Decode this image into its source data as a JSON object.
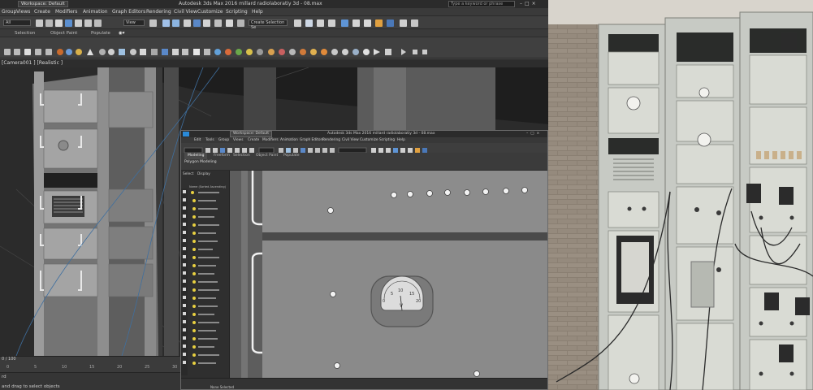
{
  "titlebar": {
    "workspace": "Workspace: Default",
    "title": "Autodesk 3ds Max 2016     millard radiolaboratiy 3d - 08.max",
    "search_placeholder": "Type a keyword or phrase"
  },
  "menu": [
    "Group",
    "Views",
    "Create",
    "Modifiers",
    "Animation",
    "Graph Editors",
    "Rendering",
    "Civil View",
    "Customize",
    "Scripting",
    "Help"
  ],
  "toolbar": {
    "selection_filter": "All",
    "view_dropdown": "View",
    "named_set": "Create Selection Se"
  },
  "ribbon": {
    "tabs": [
      "Selection",
      "Object Paint",
      "Populate"
    ]
  },
  "viewport": {
    "label": "[Camera001 ] [Realistic ]"
  },
  "timeline": {
    "frame": "0 / 100",
    "ticks": [
      "0",
      "5",
      "10",
      "15",
      "20",
      "25",
      "30"
    ]
  },
  "status": {
    "line1": "rd",
    "line2": "and drag to select objects"
  },
  "inset": {
    "workspace": "Workspace: Default",
    "title": "Autodesk 3ds Max 2016     millard radiolaboratiy 3d - 08.max",
    "menu": [
      "Edit",
      "Tools",
      "Group",
      "Views",
      "Create",
      "Modifiers",
      "Animation",
      "Graph Editors",
      "Rendering",
      "Civil View",
      "Customize",
      "Scripting",
      "Help"
    ],
    "ribbon_tabs": [
      "Modeling",
      "Freeform",
      "Selection",
      "Object Paint",
      "Populate"
    ],
    "ribbon_label": "Polygon Modeling",
    "scene_tabs": [
      "Select",
      "Display"
    ],
    "scene_header": "Name (Sorted Ascending)",
    "status": "None Selected",
    "meter_scale": [
      "0",
      "5",
      "10",
      "15",
      "20"
    ],
    "meter_unit": "V"
  }
}
